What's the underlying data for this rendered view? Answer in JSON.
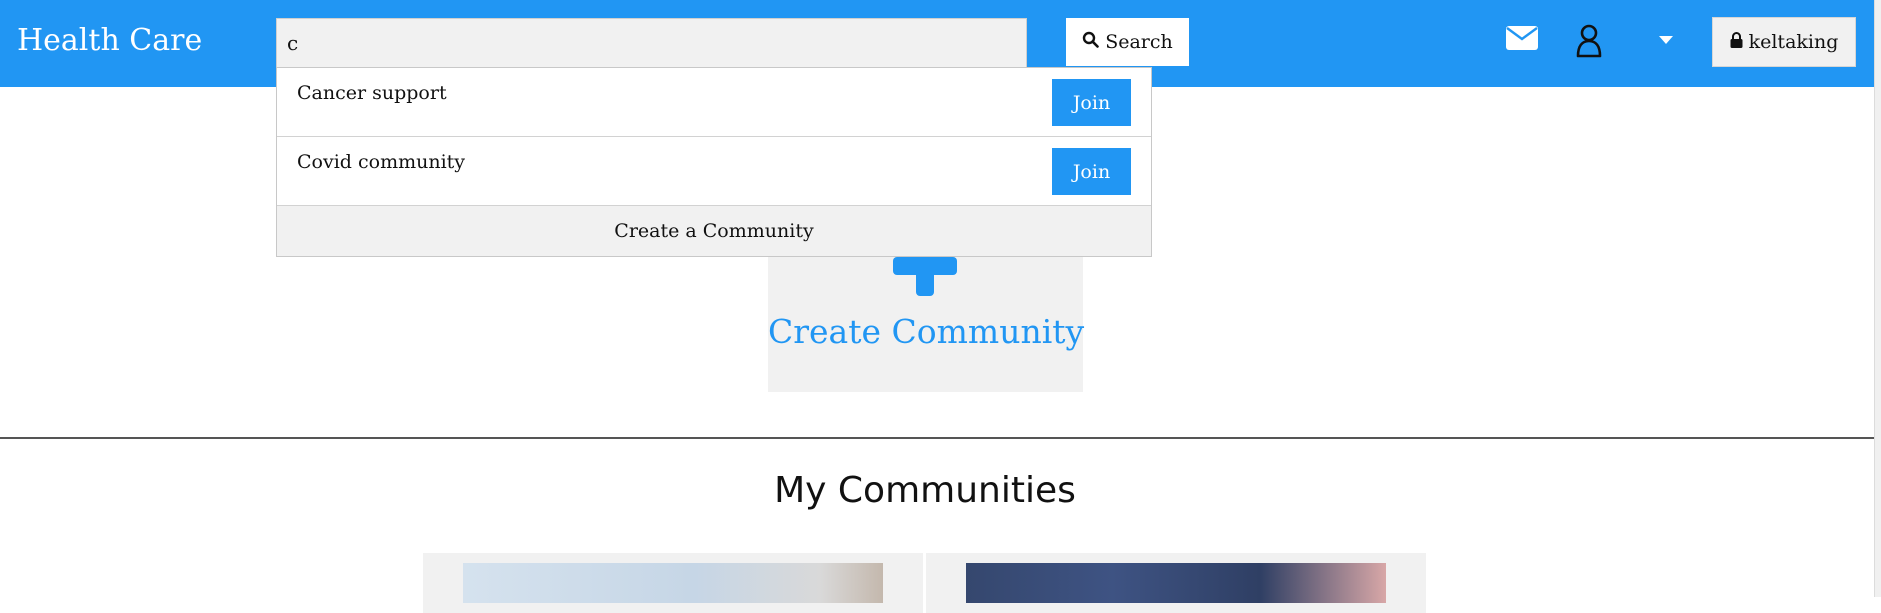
{
  "colors": {
    "brand_blue": "#2196f3",
    "button_gray": "#f1f1f1"
  },
  "header": {
    "brand": "Health Care",
    "search_value": "c",
    "search_button_label": "Search",
    "icons": [
      "mail-icon",
      "user-icon",
      "caret-down-icon",
      "lock-icon"
    ],
    "user_label": "keltaking"
  },
  "dropdown": {
    "results": [
      {
        "label": "Cancer support",
        "join_label": "Join"
      },
      {
        "label": "Covid community",
        "join_label": "Join"
      }
    ],
    "create_label": "Create a Community"
  },
  "main": {
    "create_card_label": "Create Community",
    "section_title": "My Communities"
  }
}
